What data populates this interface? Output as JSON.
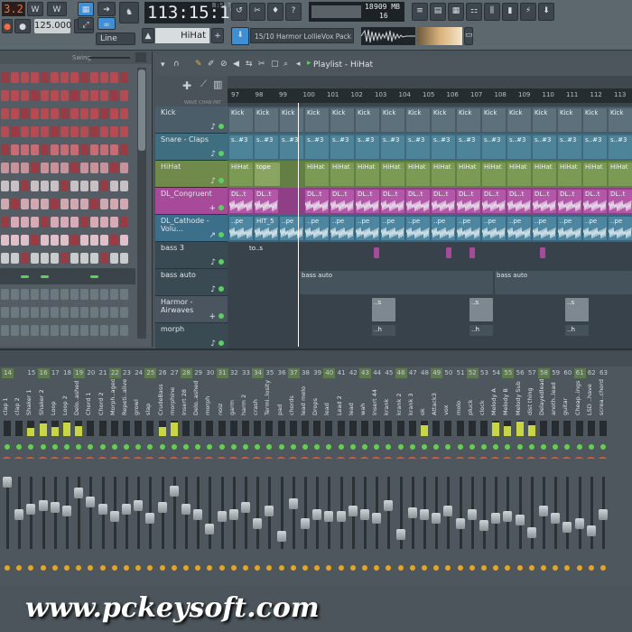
{
  "toolbar": {
    "pattern_num": "3.2",
    "time": "113:15:19",
    "time_sub": "B:S:T",
    "tempo": "125.000",
    "snap": "Line",
    "hihat_field": "HiHat",
    "hint": "15/10  Harmor LollieVox Pack",
    "cpu_val": "18",
    "mem": "909 MB",
    "poly": "16",
    "accent": "#3d8fd6"
  },
  "rack": {
    "swing_label": "Swing"
  },
  "playlist": {
    "title": "Playlist - HiHat",
    "ruler": [
      "97",
      "98",
      "99",
      "100",
      "101",
      "102",
      "103",
      "104",
      "105",
      "106",
      "107",
      "108",
      "109",
      "110",
      "111",
      "112",
      "113"
    ],
    "tools_label": "WAVE  CHAN  PAT",
    "tracks": [
      {
        "name": "Kick",
        "color": "#4a5d68"
      },
      {
        "name": "Snare - Claps",
        "color": "#3e6e80"
      },
      {
        "name": "HiHat",
        "color": "#6f8a4a"
      },
      {
        "name": "DL_Congruent",
        "color": "#a74a99"
      },
      {
        "name": "DL_Cathode - Volu…",
        "color": "#3b6f8a"
      },
      {
        "name": "bass 3",
        "color": "#3a4a53"
      },
      {
        "name": "bass auto",
        "color": "#3a4a53"
      },
      {
        "name": "Harmor - Airwaves",
        "color": "#4a5560"
      },
      {
        "name": "morph",
        "color": "#3a4a53"
      }
    ],
    "clip_labels": {
      "kick": "Kick",
      "snare": "s..#3",
      "hihat": "HiHat",
      "hihat_tope": "tope",
      "congruent": "DL..t",
      "cathode": "..pe",
      "cathode_hit": "HIT_5",
      "bass3": "to..s",
      "bass_auto": "bass auto",
      "harmor": "..s",
      "morph": "..h"
    }
  },
  "mixer": {
    "channels": [
      {
        "n": "14",
        "name": "clap 1"
      },
      {
        "n": "",
        "name": "clap 2"
      },
      {
        "n": "15",
        "name": "Shaker 1"
      },
      {
        "n": "16",
        "name": "Shaker 2"
      },
      {
        "n": "17",
        "name": "Loop"
      },
      {
        "n": "18",
        "name": "Loop 2"
      },
      {
        "n": "19",
        "name": "Delo..ashed"
      },
      {
        "n": "20",
        "name": "Chord 1"
      },
      {
        "n": "21",
        "name": "Chord 2"
      },
      {
        "n": "22",
        "name": "Morph..aged"
      },
      {
        "n": "23",
        "name": "Repeti..alive"
      },
      {
        "n": "24",
        "name": "growl"
      },
      {
        "n": "25",
        "name": "slap"
      },
      {
        "n": "26",
        "name": "CrudeBass"
      },
      {
        "n": "27",
        "name": "morphine"
      },
      {
        "n": "28",
        "name": "Insert 28"
      },
      {
        "n": "29",
        "name": "Delo..ashed"
      },
      {
        "n": "30",
        "name": "morph"
      },
      {
        "n": "31",
        "name": "noiz"
      },
      {
        "n": "32",
        "name": "garm"
      },
      {
        "n": "33",
        "name": "harm 2"
      },
      {
        "n": "34",
        "name": "crash"
      },
      {
        "n": "35",
        "name": "Termi..losity"
      },
      {
        "n": "36",
        "name": "pad"
      },
      {
        "n": "37",
        "name": "chords"
      },
      {
        "n": "38",
        "name": "lead melo"
      },
      {
        "n": "39",
        "name": "Drops"
      },
      {
        "n": "40",
        "name": "lead"
      },
      {
        "n": "41",
        "name": "Lead 2"
      },
      {
        "n": "42",
        "name": "lead"
      },
      {
        "n": "43",
        "name": "wah"
      },
      {
        "n": "44",
        "name": "Insert 44"
      },
      {
        "n": "45",
        "name": "krank"
      },
      {
        "n": "46",
        "name": "krank 2"
      },
      {
        "n": "47",
        "name": "krank 3"
      },
      {
        "n": "48",
        "name": "ok"
      },
      {
        "n": "49",
        "name": "Attack3"
      },
      {
        "n": "50",
        "name": "vox"
      },
      {
        "n": "51",
        "name": "molo"
      },
      {
        "n": "52",
        "name": "pluck"
      },
      {
        "n": "53",
        "name": "clock"
      },
      {
        "n": "54",
        "name": "Melody A"
      },
      {
        "n": "55",
        "name": "Melody B"
      },
      {
        "n": "56",
        "name": "Melody Sub"
      },
      {
        "n": "57",
        "name": "dist thing"
      },
      {
        "n": "58",
        "name": "Delayedlead"
      },
      {
        "n": "59",
        "name": "anoth..lead"
      },
      {
        "n": "60",
        "name": "guitar"
      },
      {
        "n": "61",
        "name": "Cheap..ings"
      },
      {
        "n": "62",
        "name": "LSD ..have"
      },
      {
        "n": "63",
        "name": "screa..chord"
      }
    ]
  },
  "watermark": "www.pckeysoft.com"
}
